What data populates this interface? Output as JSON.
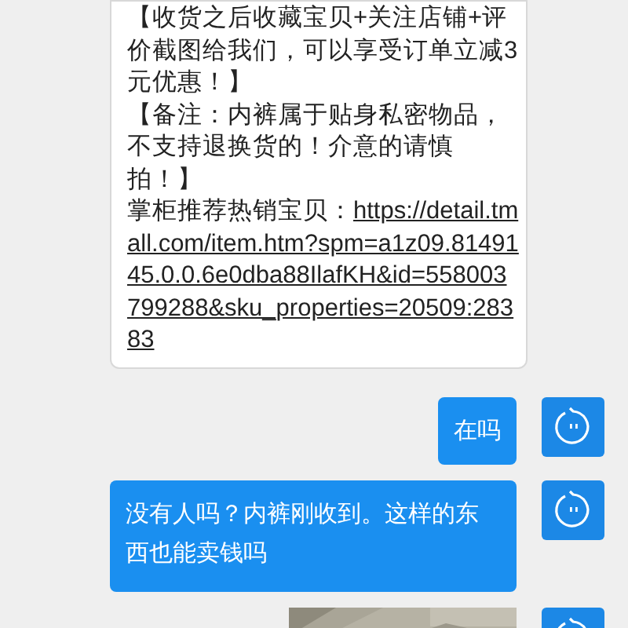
{
  "messages": [
    {
      "kind": "incoming",
      "paragraphs": [
        "【收货之后收藏宝贝+关注店铺+评价截图给我们，可以享受订单立减3元优惠！】",
        "【备注：内裤属于贴身私密物品，不支持退换货的！介意的请慎拍！】"
      ],
      "lead": "掌柜推荐热销宝贝：",
      "link": "https://detail.tmall.com/item.htm?spm=a1z09.8149145.0.0.6e0dba88IlafKH&id=558003799288&sku_properties=20509:28383"
    },
    {
      "kind": "outgoing",
      "text": "在吗"
    },
    {
      "kind": "outgoing",
      "text": "没有人吗？内裤刚收到。这样的东西也能卖钱吗"
    },
    {
      "kind": "outgoing_image"
    }
  ]
}
